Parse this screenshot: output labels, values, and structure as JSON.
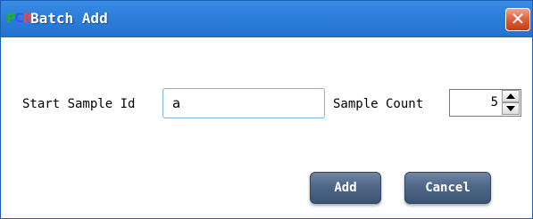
{
  "window": {
    "icon_letters": [
      "P",
      "C",
      "R"
    ],
    "title": "Batch Add",
    "close_glyph": "✕"
  },
  "form": {
    "start_sample_id_label": "Start Sample Id",
    "start_sample_id_value": "a",
    "sample_count_label": "Sample Count",
    "sample_count_value": "5"
  },
  "buttons": {
    "add_label": "Add",
    "cancel_label": "Cancel"
  },
  "colors": {
    "titlebar": "#2d7fdc",
    "close_button": "#d9512c",
    "action_button": "#4e6786"
  }
}
